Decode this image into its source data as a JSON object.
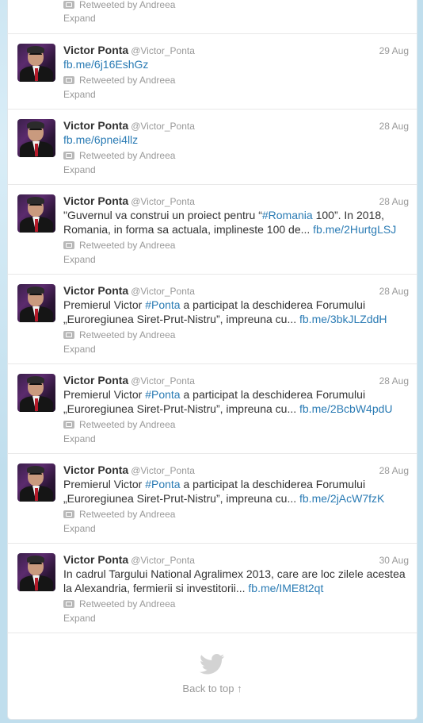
{
  "stream": {
    "partial_top": {
      "retweeted_by": "Retweeted by Andreea",
      "expand": "Expand"
    },
    "tweets": [
      {
        "fullname": "Victor Ponta",
        "username": "@Victor_Ponta",
        "date": "29 Aug",
        "text_link": "fb.me/6j16EshGz",
        "retweeted_by": "Retweeted by Andreea",
        "expand": "Expand"
      },
      {
        "fullname": "Victor Ponta",
        "username": "@Victor_Ponta",
        "date": "28 Aug",
        "text_link": "fb.me/6pnei4llz",
        "retweeted_by": "Retweeted by Andreea",
        "expand": "Expand"
      },
      {
        "fullname": "Victor Ponta",
        "username": "@Victor_Ponta",
        "date": "28 Aug",
        "text_a": "\"Guvernul va construi un proiect pentru “",
        "hashtag": "#Romania",
        "text_b": " 100”. In 2018, Romania, in forma sa actuala, implineste 100 de... ",
        "text_link": "fb.me/2HurtgLSJ",
        "retweeted_by": "Retweeted by Andreea",
        "expand": "Expand"
      },
      {
        "fullname": "Victor Ponta",
        "username": "@Victor_Ponta",
        "date": "28 Aug",
        "text_a": "Premierul Victor ",
        "hashtag": "#Ponta",
        "text_b": " a participat la deschiderea Forumului „Euroregiunea Siret-Prut-Nistru”, impreuna cu... ",
        "text_link": "fb.me/3bkJLZddH",
        "retweeted_by": "Retweeted by Andreea",
        "expand": "Expand"
      },
      {
        "fullname": "Victor Ponta",
        "username": "@Victor_Ponta",
        "date": "28 Aug",
        "text_a": "Premierul Victor ",
        "hashtag": "#Ponta",
        "text_b": " a participat la deschiderea Forumului „Euroregiunea Siret-Prut-Nistru”, impreuna cu... ",
        "text_link": "fb.me/2BcbW4pdU",
        "retweeted_by": "Retweeted by Andreea",
        "expand": "Expand"
      },
      {
        "fullname": "Victor Ponta",
        "username": "@Victor_Ponta",
        "date": "28 Aug",
        "text_a": "Premierul Victor ",
        "hashtag": "#Ponta",
        "text_b": " a participat la deschiderea Forumului „Euroregiunea Siret-Prut-Nistru”, impreuna cu... ",
        "text_link": "fb.me/2jAcW7fzK",
        "retweeted_by": "Retweeted by Andreea",
        "expand": "Expand"
      },
      {
        "fullname": "Victor Ponta",
        "username": "@Victor_Ponta",
        "date": "30 Aug",
        "text_a": "In cadrul Targului National Agralimex 2013, care are loc zilele acestea la Alexandria, fermierii si investitorii... ",
        "text_link": "fb.me/IME8t2qt",
        "retweeted_by": "Retweeted by Andreea",
        "expand": "Expand"
      }
    ]
  },
  "footer": {
    "back_to_top": "Back to top ↑",
    "icon": "twitter-bird-icon"
  },
  "colors": {
    "background": "#c0deed",
    "link": "#2a7bb4",
    "muted": "#999999"
  }
}
